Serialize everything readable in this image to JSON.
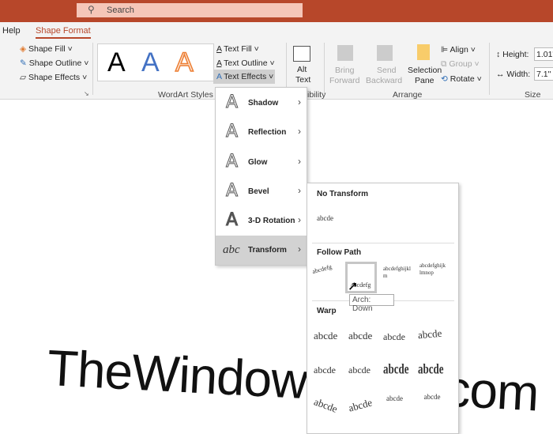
{
  "search": {
    "placeholder": "Search",
    "icon": "search-icon"
  },
  "tabs": [
    {
      "label": "Help"
    },
    {
      "label": "Shape Format"
    }
  ],
  "ribbon": {
    "shape_styles": {
      "fill": "Shape Fill",
      "outline": "Shape Outline",
      "effects": "Shape Effects"
    },
    "wordart": {
      "samples": [
        "A",
        "A",
        "A"
      ],
      "text_fill": "Text Fill",
      "text_outline": "Text Outline",
      "text_effects": "Text Effects",
      "label": "WordArt Styles"
    },
    "accessibility": {
      "alt1": "Alt",
      "alt2": "Text",
      "label": "ibility"
    },
    "arrange": {
      "bring1": "Bring",
      "bring2": "Forward",
      "send1": "Send",
      "send2": "Backward",
      "sel1": "Selection",
      "sel2": "Pane",
      "align": "Align",
      "group": "Group",
      "rotate": "Rotate",
      "label": "Arrange"
    },
    "size": {
      "height_label": "Height:",
      "height_value": "1.01\"",
      "width_label": "Width:",
      "width_value": "7.1\"",
      "label": "Size"
    }
  },
  "text_effects_menu": [
    {
      "label": "Shadow"
    },
    {
      "label": "Reflection"
    },
    {
      "label": "Glow"
    },
    {
      "label": "Bevel"
    },
    {
      "label": "3-D Rotation"
    },
    {
      "label": "Transform"
    }
  ],
  "transform": {
    "no_transform": "No Transform",
    "no_transform_sample": "abcde",
    "follow_path": "Follow Path",
    "follow_samples": [
      "abcdefg",
      "abcdefg",
      "abcdefghijklm",
      "abcdefghijklmnop"
    ],
    "tooltip": "Arch: Down",
    "warp": "Warp",
    "warp_samples": [
      "abcde",
      "abcde",
      "abcde",
      "abcde",
      "abcde",
      "abcde",
      "abcde",
      "abcde",
      "abcde",
      "abcde",
      "abcde",
      "abcde"
    ]
  },
  "slide": {
    "text": "TheWindowsClub.com"
  },
  "colors": {
    "accent": "#b7472a"
  }
}
